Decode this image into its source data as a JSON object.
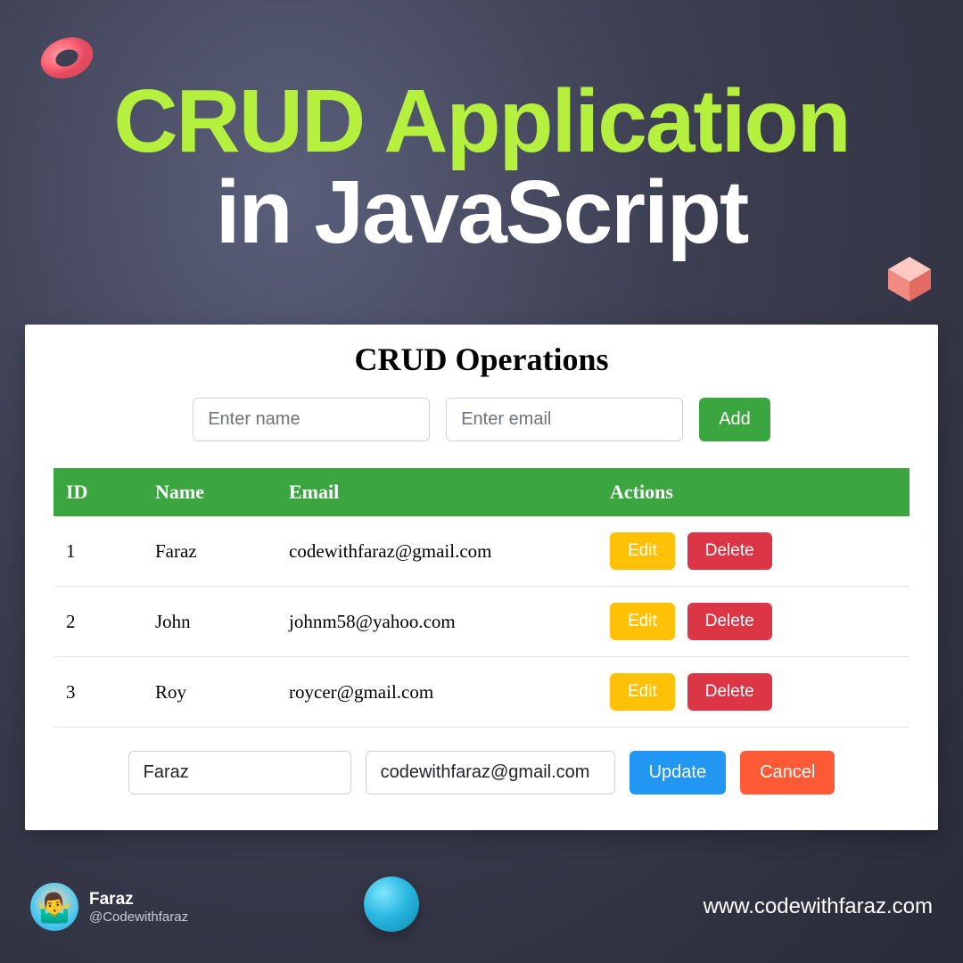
{
  "title": {
    "line1": "CRUD Application",
    "line2": "in JavaScript"
  },
  "card": {
    "heading": "CRUD Operations",
    "name_placeholder": "Enter name",
    "email_placeholder": "Enter email",
    "add_label": "Add",
    "columns": {
      "id": "ID",
      "name": "Name",
      "email": "Email",
      "actions": "Actions"
    },
    "edit_label": "Edit",
    "delete_label": "Delete",
    "rows": [
      {
        "id": "1",
        "name": "Faraz",
        "email": "codewithfaraz@gmail.com"
      },
      {
        "id": "2",
        "name": "John",
        "email": "johnm58@yahoo.com"
      },
      {
        "id": "3",
        "name": "Roy",
        "email": "roycer@gmail.com"
      }
    ],
    "edit_form": {
      "name_value": "Faraz",
      "email_value": "codewithfaraz@gmail.com",
      "update_label": "Update",
      "cancel_label": "Cancel"
    }
  },
  "footer": {
    "name": "Faraz",
    "handle": "@Codewithfaraz",
    "url": "www.codewithfaraz.com"
  }
}
